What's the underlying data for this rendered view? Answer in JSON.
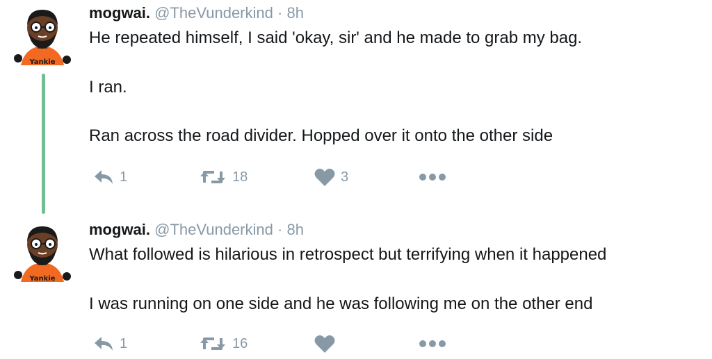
{
  "tweets": [
    {
      "display_name": "mogwai.",
      "handle": "@TheVunderkind",
      "separator": "·",
      "time": "8h",
      "lines": [
        "He repeated himself, I said 'okay, sir' and he made to grab my bag.",
        "I ran.",
        "Ran across the road divider. Hopped over it onto the other side"
      ],
      "reply_count": "1",
      "retweet_count": "18",
      "like_count": "3",
      "avatar_shirt_text": "Yankie"
    },
    {
      "display_name": "mogwai.",
      "handle": "@TheVunderkind",
      "separator": "·",
      "time": "8h",
      "lines": [
        "What followed is hilarious in retrospect but terrifying when it happened",
        "I was running on one side and he was following me on the other end"
      ],
      "reply_count": "1",
      "retweet_count": "16",
      "like_count": "",
      "avatar_shirt_text": "Yankie"
    }
  ],
  "icons": {
    "reply": "reply-icon",
    "retweet": "retweet-icon",
    "like": "heart-icon",
    "more": "more-icon"
  },
  "colors": {
    "thread_line": "#6fbf93",
    "muted": "#8899a6",
    "text": "#14171a",
    "shirt": "#f26a21"
  }
}
